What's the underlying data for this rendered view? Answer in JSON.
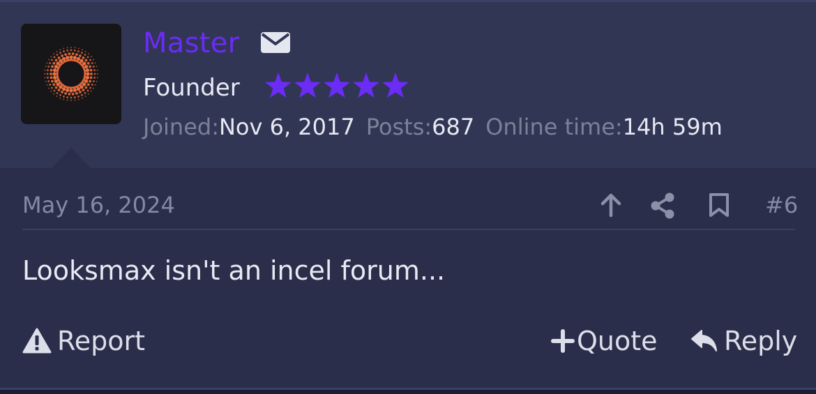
{
  "user": {
    "name": "Master",
    "title": "Founder",
    "star_count": 5,
    "name_color": "#6b2cf5",
    "star_color": "#6b2cf5",
    "avatar_icon": "orange-dotted-ring-icon",
    "stats": {
      "joined_label": "Joined:",
      "joined_value": "Nov 6, 2017",
      "posts_label": "Posts:",
      "posts_value": "687",
      "online_label": "Online time:",
      "online_value": "14h 59m"
    }
  },
  "post": {
    "date": "May 16, 2024",
    "number": "#6",
    "message": "Looksmax isn't an incel forum...",
    "icons": [
      "arrow-up-icon",
      "share-icon",
      "bookmark-icon"
    ]
  },
  "actions": {
    "report_label": "Report",
    "quote_label": "Quote",
    "reply_label": "Reply"
  }
}
